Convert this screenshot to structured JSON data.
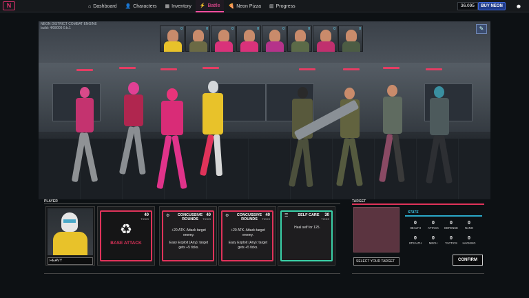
{
  "app": {
    "logo_text": "N"
  },
  "nav": [
    {
      "icon": "⌂",
      "label": "Dashboard",
      "active": false
    },
    {
      "icon": "👤",
      "label": "Characters",
      "active": false
    },
    {
      "icon": "▦",
      "label": "Inventory",
      "active": false
    },
    {
      "icon": "⚡",
      "label": "Battle",
      "active": true
    },
    {
      "icon": "🍕",
      "label": "Neon Pizza",
      "active": false
    },
    {
      "icon": "▥",
      "label": "Progress",
      "active": false
    }
  ],
  "header": {
    "neon_balance": "36.095",
    "buy_label": "BUY NEON"
  },
  "scene": {
    "title_line1": "NEON DISTRICT COMBAT ENGINE",
    "title_line2": "build: 4f08009 0.b.1",
    "turn_order": [
      {
        "num": "0",
        "color": "#e8c22a"
      },
      {
        "num": "0",
        "color": "#6b6a45"
      },
      {
        "num": "0",
        "color": "#d9327a"
      },
      {
        "num": "0",
        "color": "#d9327a"
      },
      {
        "num": "0",
        "color": "#b5338a"
      },
      {
        "num": "0",
        "color": "#5b6a48"
      },
      {
        "num": "0",
        "color": "#c0306e"
      },
      {
        "num": "0",
        "color": "#4c5c44"
      }
    ]
  },
  "player": {
    "section_label": "PLAYER",
    "name": "HEAVY"
  },
  "cards": {
    "base": {
      "title": "BASE ATTACK",
      "cost": "40",
      "unit": "TICKS"
    },
    "c1": {
      "title": "CONCUSSIVE ROUNDS",
      "cost": "40",
      "unit": "TICKS",
      "desc1": "+20 ATK. Attack target enemy.",
      "desc2": "Easy Exploit (Any): target gets +5 ticks."
    },
    "c2": {
      "title": "CONCUSSIVE ROUNDS",
      "cost": "40",
      "unit": "TICKS",
      "desc1": "+20 ATK. Attack target enemy.",
      "desc2": "Easy Exploit (Any): target gets +5 ticks."
    },
    "c3": {
      "title": "SELF CARE",
      "cost": "30",
      "unit": "TICKS",
      "desc1": "Heal self for 125."
    }
  },
  "target": {
    "section_label": "TARGET",
    "select_label": "SELECT YOUR TARGET",
    "stats_title": "STATS",
    "stats": [
      {
        "k": "HEALTH",
        "v": "0"
      },
      {
        "k": "ATTACK",
        "v": "0"
      },
      {
        "k": "DEFENSE",
        "v": "0"
      },
      {
        "k": "NANO",
        "v": "0"
      },
      {
        "k": "STEALTH",
        "v": "0"
      },
      {
        "k": "MECH",
        "v": "0"
      },
      {
        "k": "TACTICS",
        "v": "0"
      },
      {
        "k": "HACKING",
        "v": "0"
      }
    ],
    "confirm_label": "CONFIRM"
  },
  "colors": {
    "accent_pink": "#ff4fa0",
    "accent_red": "#e0335a",
    "accent_teal": "#3ad1a8",
    "accent_blue": "#3fc7e8"
  }
}
